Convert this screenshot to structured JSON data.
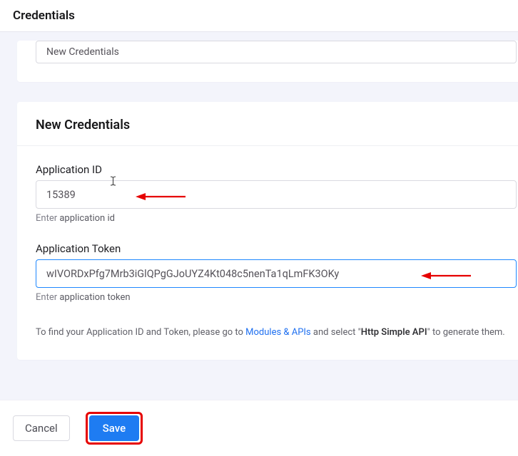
{
  "header": {
    "title": "Credentials"
  },
  "previous_card": {
    "input_value": "New Credentials"
  },
  "main_card": {
    "title": "New Credentials",
    "app_id": {
      "label": "Application ID",
      "value": "15389",
      "hint_prefix": "Enter ",
      "hint_emph": "application id"
    },
    "app_token": {
      "label": "Application Token",
      "value": "wIVORDxPfg7Mrb3iGlQPgGJoUYZ4Kt048c5nenTa1qLmFK3OKy",
      "hint_prefix": "Enter ",
      "hint_emph": "application token"
    },
    "info": {
      "prefix": "To find your Application ID and Token, please go to ",
      "link": "Modules & APIs",
      "mid": " and select \"",
      "bold": "Http Simple API",
      "suffix": "\" to generate them."
    }
  },
  "footer": {
    "cancel": "Cancel",
    "save": "Save"
  },
  "annotations": {
    "arrow_color": "#e60000"
  }
}
